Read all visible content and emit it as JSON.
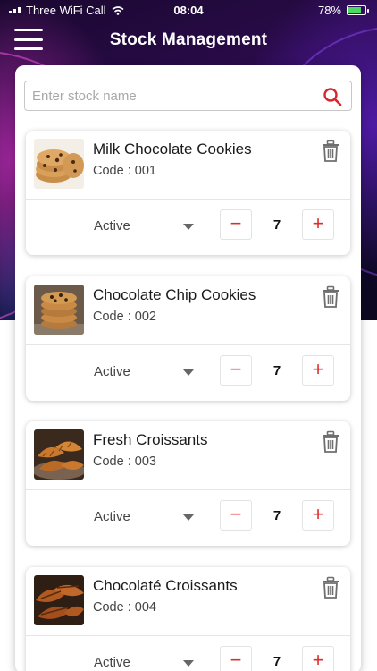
{
  "status_bar": {
    "carrier": "Three WiFi Call",
    "time": "08:04",
    "battery": "78%"
  },
  "header": {
    "title": "Stock Management",
    "menu_icon": "hamburger-menu-icon"
  },
  "search": {
    "placeholder": "Enter stock name",
    "value": "",
    "icon": "search-icon",
    "icon_color": "#d9272e"
  },
  "colors": {
    "accent": "#e02b2b",
    "battery": "#4cd964"
  },
  "stock_items": [
    {
      "name": "Milk Chocolate Cookies",
      "code": "Code : 001",
      "status": "Active",
      "quantity": "7",
      "minus": "−",
      "plus": "+"
    },
    {
      "name": "Chocolate Chip Cookies",
      "code": "Code : 002",
      "status": "Active",
      "quantity": "7",
      "minus": "−",
      "plus": "+"
    },
    {
      "name": "Fresh Croissants",
      "code": "Code : 003",
      "status": "Active",
      "quantity": "7",
      "minus": "−",
      "plus": "+"
    },
    {
      "name": "Chocolaté Croissants",
      "code": "Code : 004",
      "status": "Active",
      "quantity": "7",
      "minus": "−",
      "plus": "+"
    }
  ]
}
